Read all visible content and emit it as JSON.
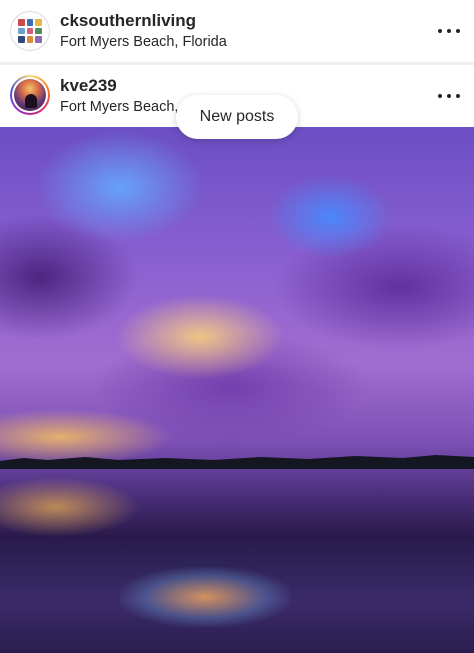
{
  "posts": [
    {
      "username": "cksouthernliving",
      "location": "Fort Myers Beach, Florida",
      "avatar_icon": "profile-collage-icon",
      "more_icon": "more-options-icon"
    },
    {
      "username": "kve239",
      "location": "Fort Myers Beach,",
      "avatar_icon": "profile-photo-icon",
      "more_icon": "more-options-icon"
    }
  ],
  "banner": {
    "new_posts_label": "New posts"
  },
  "colors": {
    "text": "#262626",
    "separator": "#efefef"
  }
}
